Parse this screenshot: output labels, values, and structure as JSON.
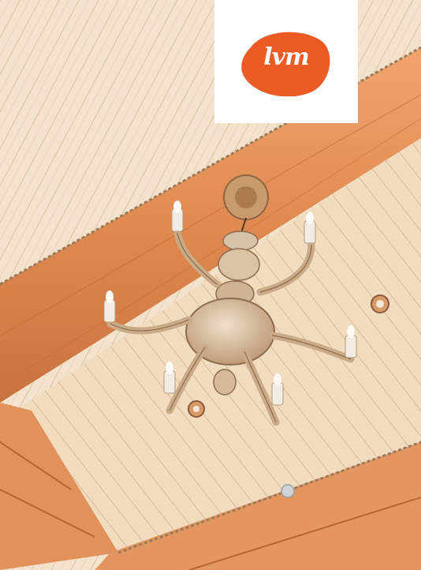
{
  "logo": {
    "text": "lvm",
    "brand_color": "#ec5b24",
    "background": "#ffffff"
  },
  "photo": {
    "colors": {
      "ceiling_plank": "#f3e1c8",
      "log_beam": "#e4905a",
      "chandelier": "#d9c1a3"
    }
  }
}
